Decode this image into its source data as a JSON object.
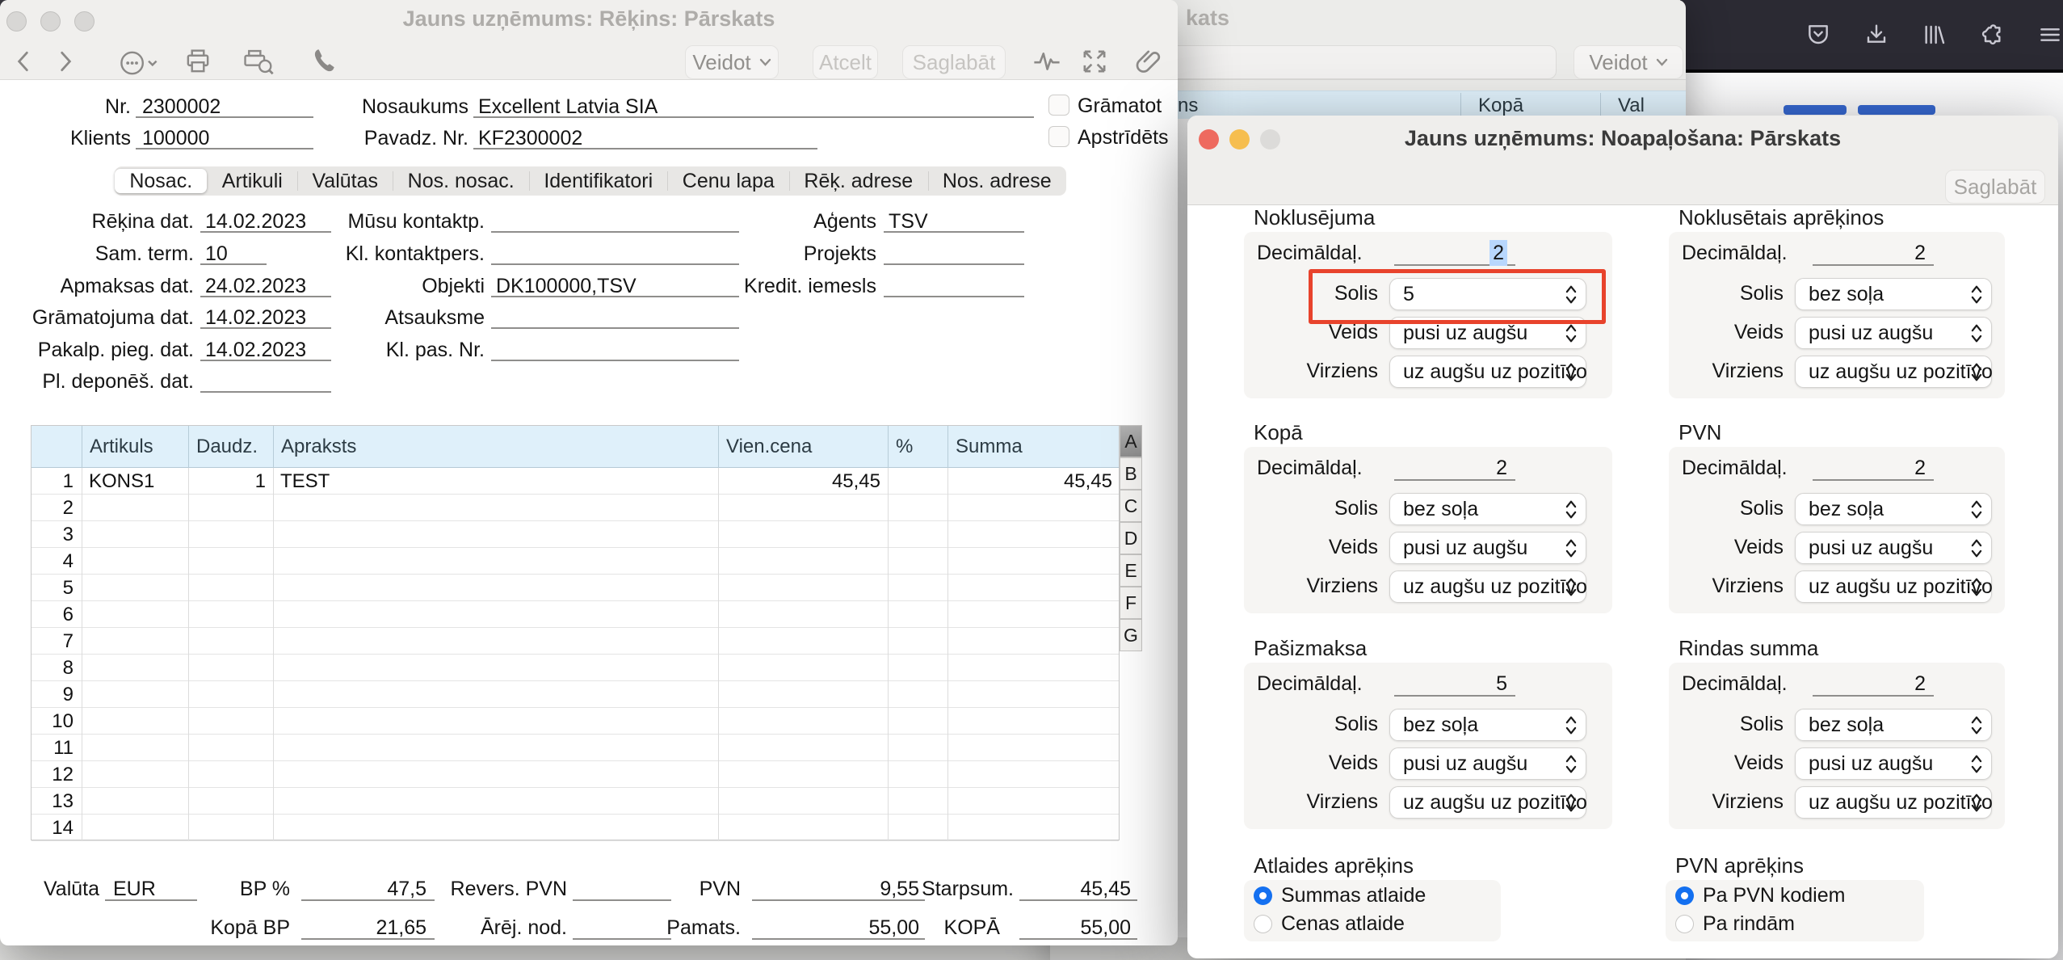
{
  "invoice_window": {
    "title": "Jauns uzņēmums: Rēķins: Pārskats",
    "toolbar": {
      "veidot": "Veidot",
      "atcelt": "Atcelt",
      "saglabat": "Saglabāt"
    },
    "header_fields": [
      {
        "label": "Nr.",
        "value": "2300002"
      },
      {
        "label": "Nosaukums",
        "value": "Excellent Latvia SIA"
      },
      {
        "label": "Klients",
        "value": "100000"
      },
      {
        "label": "Pavadz. Nr.",
        "value": "KF2300002"
      }
    ],
    "checkboxes": [
      {
        "label": "Grāmatot",
        "checked": false
      },
      {
        "label": "Apstrīdēts",
        "checked": false
      }
    ],
    "tabs": [
      {
        "label": "Nosac.",
        "active": true
      },
      {
        "label": "Artikuli",
        "active": false
      },
      {
        "label": "Valūtas",
        "active": false
      },
      {
        "label": "Nos. nosac.",
        "active": false
      },
      {
        "label": "Identifikatori",
        "active": false
      },
      {
        "label": "Cenu lapa",
        "active": false
      },
      {
        "label": "Rēķ. adrese",
        "active": false
      },
      {
        "label": "Nos. adrese",
        "active": false
      }
    ],
    "form": {
      "left": [
        {
          "label": "Rēķina dat.",
          "value": "14.02.2023"
        },
        {
          "label": "Sam. term.",
          "value": "10"
        },
        {
          "label": "Apmaksas dat.",
          "value": "24.02.2023"
        },
        {
          "label": "Grāmatojuma dat.",
          "value": "14.02.2023"
        },
        {
          "label": "Pakalp. pieg. dat.",
          "value": "14.02.2023"
        },
        {
          "label": "Pl. deponēš. dat.",
          "value": ""
        }
      ],
      "middle": [
        {
          "label": "Mūsu kontaktp.",
          "value": ""
        },
        {
          "label": "Kl. kontaktpers.",
          "value": ""
        },
        {
          "label": "Objekti",
          "value": "DK100000,TSV"
        },
        {
          "label": "Atsauksme",
          "value": ""
        },
        {
          "label": "Kl. pas. Nr.",
          "value": ""
        }
      ],
      "right": [
        {
          "label": "Aģents",
          "value": "TSV"
        },
        {
          "label": "Projekts",
          "value": ""
        },
        {
          "label": "Kredit. iemesls",
          "value": ""
        }
      ]
    },
    "table": {
      "columns": [
        "",
        "Artikuls",
        "Daudz.",
        "Apraksts",
        "Vien.cena",
        "%",
        "Summa"
      ],
      "rows": [
        [
          "1",
          "KONS1",
          "1",
          "TEST",
          "45,45",
          "",
          "45,45"
        ]
      ],
      "row_count": 14,
      "side_tabs": [
        "A",
        "B",
        "C",
        "D",
        "E",
        "F",
        "G"
      ]
    },
    "totals": {
      "row1": [
        {
          "label": "Valūta",
          "value": "EUR"
        },
        {
          "label": "BP %",
          "value": "47,5"
        },
        {
          "label": "Revers. PVN",
          "value": ""
        },
        {
          "label": "PVN",
          "value": "9,55"
        },
        {
          "label": "Starpsum.",
          "value": "45,45"
        }
      ],
      "row2": [
        {
          "label": "Kopā BP",
          "value": "21,65"
        },
        {
          "label": "Ārēj. nod.",
          "value": ""
        },
        {
          "label": "Pamats.",
          "value": "55,00"
        },
        {
          "label": "KOPĀ",
          "value": "55,00"
        }
      ]
    }
  },
  "rounding_window": {
    "title": "Jauns uzņēmums: Noapaļošana: Pārskats",
    "saglabat": "Saglabāt",
    "labels": {
      "decimals": "Decimāldaļ.",
      "solis": "Solis",
      "veids": "Veids",
      "virziens": "Virziens"
    },
    "sections": [
      {
        "title": "Noklusējuma",
        "decimals": "2",
        "decimals_selected": true,
        "solis": "5",
        "veids": "pusi uz augšu",
        "virziens": "uz augšu uz pozitīvo",
        "annotated": true
      },
      {
        "title": "Noklusētais aprēķinos",
        "decimals": "2",
        "decimals_selected": false,
        "solis": "bez soļa",
        "veids": "pusi uz augšu",
        "virziens": "uz augšu uz pozitīvo",
        "annotated": false
      },
      {
        "title": "Kopā",
        "decimals": "2",
        "decimals_selected": false,
        "solis": "bez soļa",
        "veids": "pusi uz augšu",
        "virziens": "uz augšu uz pozitīvo",
        "annotated": false
      },
      {
        "title": "PVN",
        "decimals": "2",
        "decimals_selected": false,
        "solis": "bez soļa",
        "veids": "pusi uz augšu",
        "virziens": "uz augšu uz pozitīvo",
        "annotated": false
      },
      {
        "title": "Pašizmaksa",
        "decimals": "5",
        "decimals_selected": false,
        "solis": "bez soļa",
        "veids": "pusi uz augšu",
        "virziens": "uz augšu uz pozitīvo",
        "annotated": false
      },
      {
        "title": "Rindas summa",
        "decimals": "2",
        "decimals_selected": false,
        "solis": "bez soļa",
        "veids": "pusi uz augšu",
        "virziens": "uz augšu uz pozitīvo",
        "annotated": false
      }
    ],
    "radio_sections": [
      {
        "title": "Atlaides aprēķins",
        "options": [
          {
            "label": "Summas atlaide",
            "selected": true
          },
          {
            "label": "Cenas atlaide",
            "selected": false
          }
        ]
      },
      {
        "title": "PVN aprēķins",
        "options": [
          {
            "label": "Pa PVN kodiem",
            "selected": true
          },
          {
            "label": "Pa rindām",
            "selected": false
          }
        ]
      }
    ],
    "annotation_color": "#e8432c"
  },
  "browse_window": {
    "title_fragment": "kats",
    "veidot": "Veidot",
    "header_columns": [
      "ns",
      "Kopā",
      "Val"
    ]
  },
  "firefox": {
    "toolbar_color": "#2b2a33",
    "icons": [
      "pocket-icon",
      "download-icon",
      "library-icon",
      "extensions-icon",
      "menu-icon"
    ]
  }
}
